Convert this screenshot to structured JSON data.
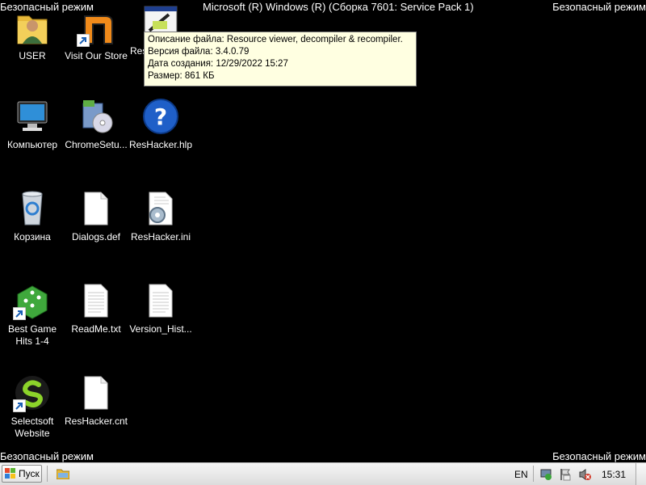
{
  "overlay": {
    "safe_mode_label": "Безопасный режим",
    "os_title": "Microsoft (R) Windows (R) (Сборка 7601: Service Pack 1)"
  },
  "desktop": {
    "icons": [
      {
        "label": "USER",
        "icon": "user-folder-icon"
      },
      {
        "label": "Visit Our Store",
        "icon": "store-shortcut-icon"
      },
      {
        "label": "Res",
        "icon": "reshacker-exe-icon"
      },
      {
        "label": "Компьютер",
        "icon": "computer-icon"
      },
      {
        "label": "ChromeSetu...",
        "icon": "chrome-setup-icon"
      },
      {
        "label": "ResHacker.hlp",
        "icon": "help-file-icon"
      },
      {
        "label": "Корзина",
        "icon": "recycle-bin-icon"
      },
      {
        "label": "Dialogs.def",
        "icon": "blank-file-icon"
      },
      {
        "label": "ResHacker.ini",
        "icon": "settings-file-icon"
      },
      {
        "label": "Best Game\nHits 1-4",
        "icon": "game-dice-icon"
      },
      {
        "label": "ReadMe.txt",
        "icon": "text-file-icon"
      },
      {
        "label": "Version_Hist...",
        "icon": "text-file-icon"
      },
      {
        "label": "Selectsoft\nWebsite",
        "icon": "selectsoft-icon"
      },
      {
        "label": "ResHacker.cnt",
        "icon": "blank-file-icon"
      }
    ]
  },
  "tooltip": {
    "description": "Описание файла: Resource viewer, decompiler & recompiler.",
    "version": "Версия файла: 3.4.0.79",
    "created": "Дата создания: 12/29/2022 15:27",
    "size": "Размер: 861 КБ"
  },
  "taskbar": {
    "start_label": "Пуск",
    "language": "EN",
    "clock": "15:31"
  },
  "colors": {
    "desktop": "#000000",
    "tooltip_bg": "#ffffe1",
    "taskbar": "#e6e6e6"
  }
}
